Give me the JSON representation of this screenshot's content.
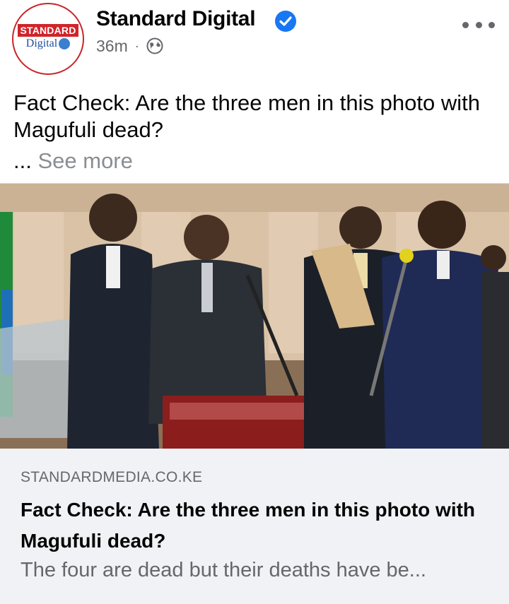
{
  "post": {
    "page_name": "Standard Digital",
    "timestamp": "36m",
    "separator": "·",
    "audience_icon": "globe-icon",
    "verified_icon": "verified-badge-icon",
    "text": "Fact Check: Are the three men in this photo with Magufuli dead?",
    "ellipsis": "...",
    "see_more": "See more",
    "avatar": {
      "logo_top": "STANDARD",
      "logo_bottom": "Digital"
    }
  },
  "link_preview": {
    "domain": "STANDARDMEDIA.CO.KE",
    "title": "Fact Check: Are the three men in this photo with Magufuli dead?",
    "description": "The four are dead but their deaths have be..."
  },
  "colors": {
    "accent_blue": "#1877f2",
    "brand_red": "#d0242a",
    "secondary_text": "#65676b",
    "card_bg": "#f0f2f5"
  }
}
